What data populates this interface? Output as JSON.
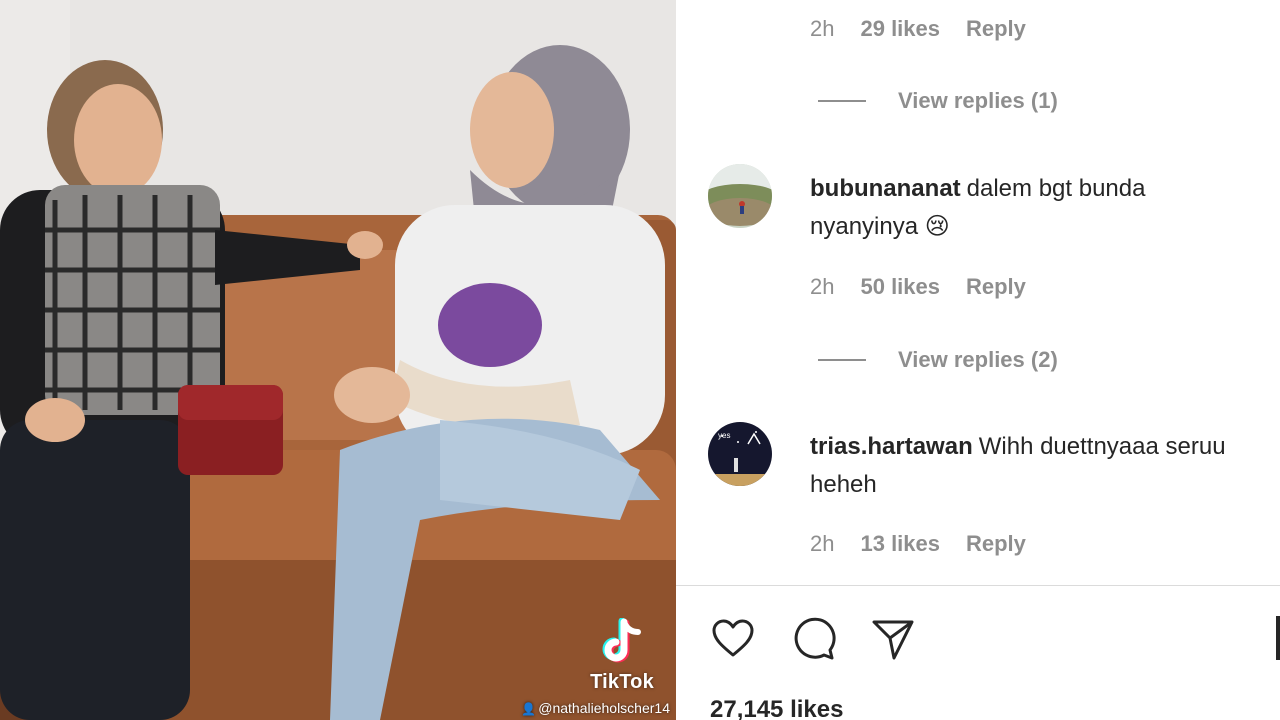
{
  "video": {
    "watermark_label": "TikTok",
    "watermark_handle": "@nathalieholscher14"
  },
  "comments_panel": {
    "top_meta": {
      "time": "2h",
      "likes": "29 likes",
      "reply": "Reply"
    },
    "view_replies_1": "View replies (1)",
    "comments": [
      {
        "username": "bubunananat",
        "text": "dalem bgt bunda nyanyinya 😢",
        "time": "2h",
        "likes": "50 likes",
        "reply": "Reply",
        "view_replies": "View replies (2)"
      },
      {
        "username": "trias.hartawan",
        "text": "Wihh duettnyaaa seruu heheh",
        "time": "2h",
        "likes": "13 likes",
        "reply": "Reply"
      }
    ]
  },
  "actions": {
    "like_icon": "heart-icon",
    "comment_icon": "comment-bubble-icon",
    "share_icon": "paper-plane-icon"
  },
  "post": {
    "likes_count": "27,145 likes"
  }
}
